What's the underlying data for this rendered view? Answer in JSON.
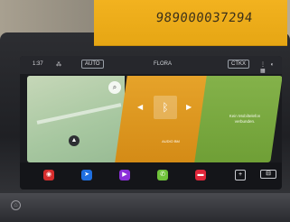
{
  "sticker": {
    "number": "989000037294"
  },
  "status_bar": {
    "time": "1:37",
    "climate_icon": "fan-icon",
    "auto_label": "AUTO",
    "center_label": "FLORA",
    "mode_label": "CTKX",
    "right_icons": "⋮ ◐ ▦"
  },
  "tiles": {
    "map": {
      "search_icon": "search-icon",
      "nav_icon": "navigation-arrow-icon"
    },
    "media": {
      "art_icon": "bluetooth-icon",
      "caption": "AUDIO BM"
    },
    "phone": {
      "message": "Kein Mobiltelefon verbunden."
    }
  },
  "dock": {
    "buttons": [
      {
        "name": "home",
        "icon": "home-icon",
        "color": "#d62d2d"
      },
      {
        "name": "nav",
        "icon": "navigation-icon",
        "color": "#1f6fe0"
      },
      {
        "name": "media",
        "icon": "play-icon",
        "color": "#8b2fd8"
      },
      {
        "name": "phone",
        "icon": "phone-icon",
        "color": "#6fc23a"
      },
      {
        "name": "car",
        "icon": "car-icon",
        "color": "#e0263a"
      },
      {
        "name": "apps",
        "icon": "plus-icon",
        "color": "#ffffff"
      },
      {
        "name": "settings",
        "icon": "car-settings-icon",
        "color": "#ffffff"
      }
    ]
  }
}
